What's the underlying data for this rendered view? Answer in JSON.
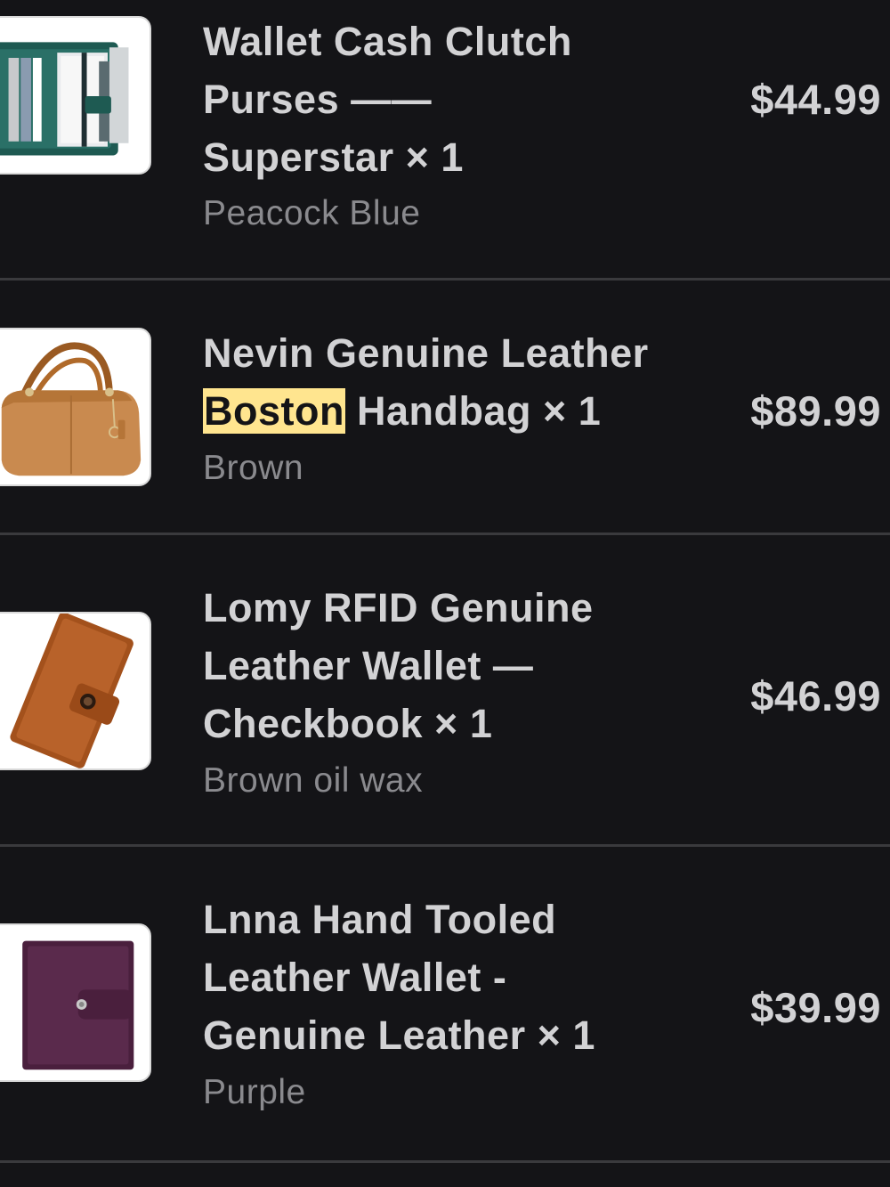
{
  "items": [
    {
      "title_lines": [
        "Wallet Cash Clutch",
        "Purses ——",
        "Superstar × 1"
      ],
      "variant": "Peacock Blue",
      "price": "$44.99",
      "image_icon": "green-wallet-icon"
    },
    {
      "title_line1": "Nevin Genuine Leather",
      "title_highlight": "Boston",
      "title_line2_rest": " Handbag × 1",
      "variant": "Brown",
      "price": "$89.99",
      "image_icon": "brown-handbag-icon"
    },
    {
      "title_lines": [
        "Lomy RFID Genuine",
        "Leather Wallet —",
        "Checkbook × 1"
      ],
      "variant": "Brown oil wax",
      "price": "$46.99",
      "image_icon": "brown-checkbook-wallet-icon"
    },
    {
      "title_lines": [
        "Lnna Hand Tooled",
        "Leather Wallet -",
        "Genuine Leather × 1"
      ],
      "variant": "Purple",
      "price": "$39.99",
      "image_icon": "purple-wallet-icon"
    }
  ],
  "colors": {
    "background": "#141417",
    "highlight": "#ffe58f",
    "divider": "#3a3a3d"
  }
}
